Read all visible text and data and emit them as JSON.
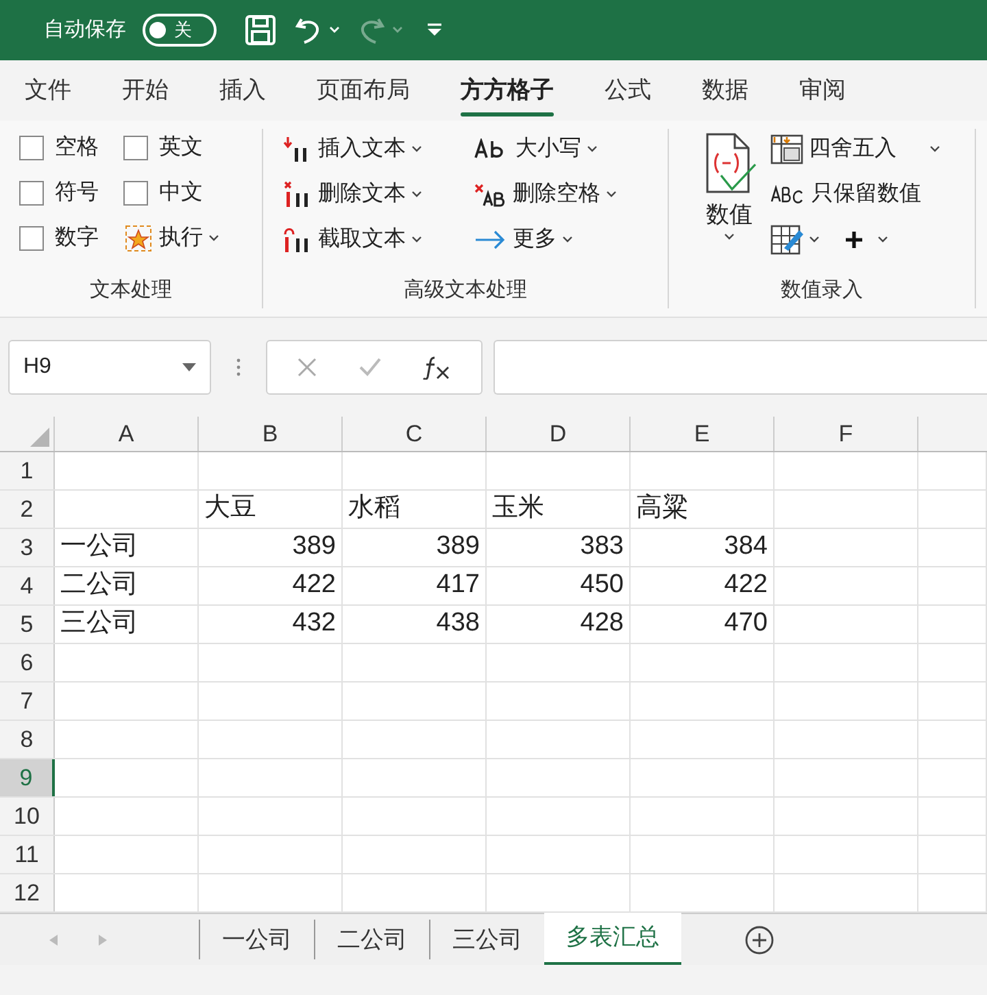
{
  "title_bar": {
    "autosave_label": "自动保存",
    "autosave_toggle": {
      "label": "关",
      "on": false
    }
  },
  "ribbon_tabs": [
    {
      "label": "文件",
      "selected": false
    },
    {
      "label": "开始",
      "selected": false
    },
    {
      "label": "插入",
      "selected": false
    },
    {
      "label": "页面布局",
      "selected": false
    },
    {
      "label": "方方格子",
      "selected": true
    },
    {
      "label": "公式",
      "selected": false
    },
    {
      "label": "数据",
      "selected": false
    },
    {
      "label": "审阅",
      "selected": false
    }
  ],
  "ribbon": {
    "text_group": {
      "title": "文本处理",
      "checkboxes": [
        {
          "label": "空格",
          "checked": false
        },
        {
          "label": "英文",
          "checked": false
        },
        {
          "label": "符号",
          "checked": false
        },
        {
          "label": "中文",
          "checked": false
        },
        {
          "label": "数字",
          "checked": false
        }
      ],
      "run_button": "执行"
    },
    "advanced_group": {
      "title": "高级文本处理",
      "items": [
        {
          "label": "插入文本",
          "kind": "insert"
        },
        {
          "label": "删除文本",
          "kind": "delete"
        },
        {
          "label": "截取文本",
          "kind": "cut"
        },
        {
          "label": "大小写",
          "kind": "case"
        },
        {
          "label": "删除空格",
          "kind": "space"
        },
        {
          "label": "更多",
          "kind": "more"
        }
      ]
    },
    "number_group": {
      "title": "数值录入",
      "big_button": "数值",
      "round_button": "四舍五入",
      "keep_button": "只保留数值"
    }
  },
  "formula_bar": {
    "name_box": "H9"
  },
  "grid": {
    "columns": [
      "A",
      "B",
      "C",
      "D",
      "E",
      "F"
    ],
    "rows": [
      {
        "header": "1",
        "selected": false,
        "cells": [
          "",
          "",
          "",
          "",
          ""
        ]
      },
      {
        "header": "2",
        "selected": false,
        "cells": [
          "",
          "大豆",
          "水稻",
          "玉米",
          "高粱"
        ]
      },
      {
        "header": "3",
        "selected": false,
        "cells": [
          "一公司",
          "389",
          "389",
          "383",
          "384"
        ]
      },
      {
        "header": "4",
        "selected": false,
        "cells": [
          "二公司",
          "422",
          "417",
          "450",
          "422"
        ]
      },
      {
        "header": "5",
        "selected": false,
        "cells": [
          "三公司",
          "432",
          "438",
          "428",
          "470"
        ]
      },
      {
        "header": "6",
        "selected": false,
        "cells": []
      },
      {
        "header": "7",
        "selected": false,
        "cells": []
      },
      {
        "header": "8",
        "selected": false,
        "cells": []
      },
      {
        "header": "9",
        "selected": true,
        "cells": []
      },
      {
        "header": "10",
        "selected": false,
        "cells": []
      },
      {
        "header": "11",
        "selected": false,
        "cells": []
      },
      {
        "header": "12",
        "selected": false,
        "cells": []
      }
    ]
  },
  "sheet_tabs": [
    {
      "label": "一公司",
      "selected": false
    },
    {
      "label": "二公司",
      "selected": false
    },
    {
      "label": "三公司",
      "selected": false
    },
    {
      "label": "多表汇总",
      "selected": true
    }
  ]
}
